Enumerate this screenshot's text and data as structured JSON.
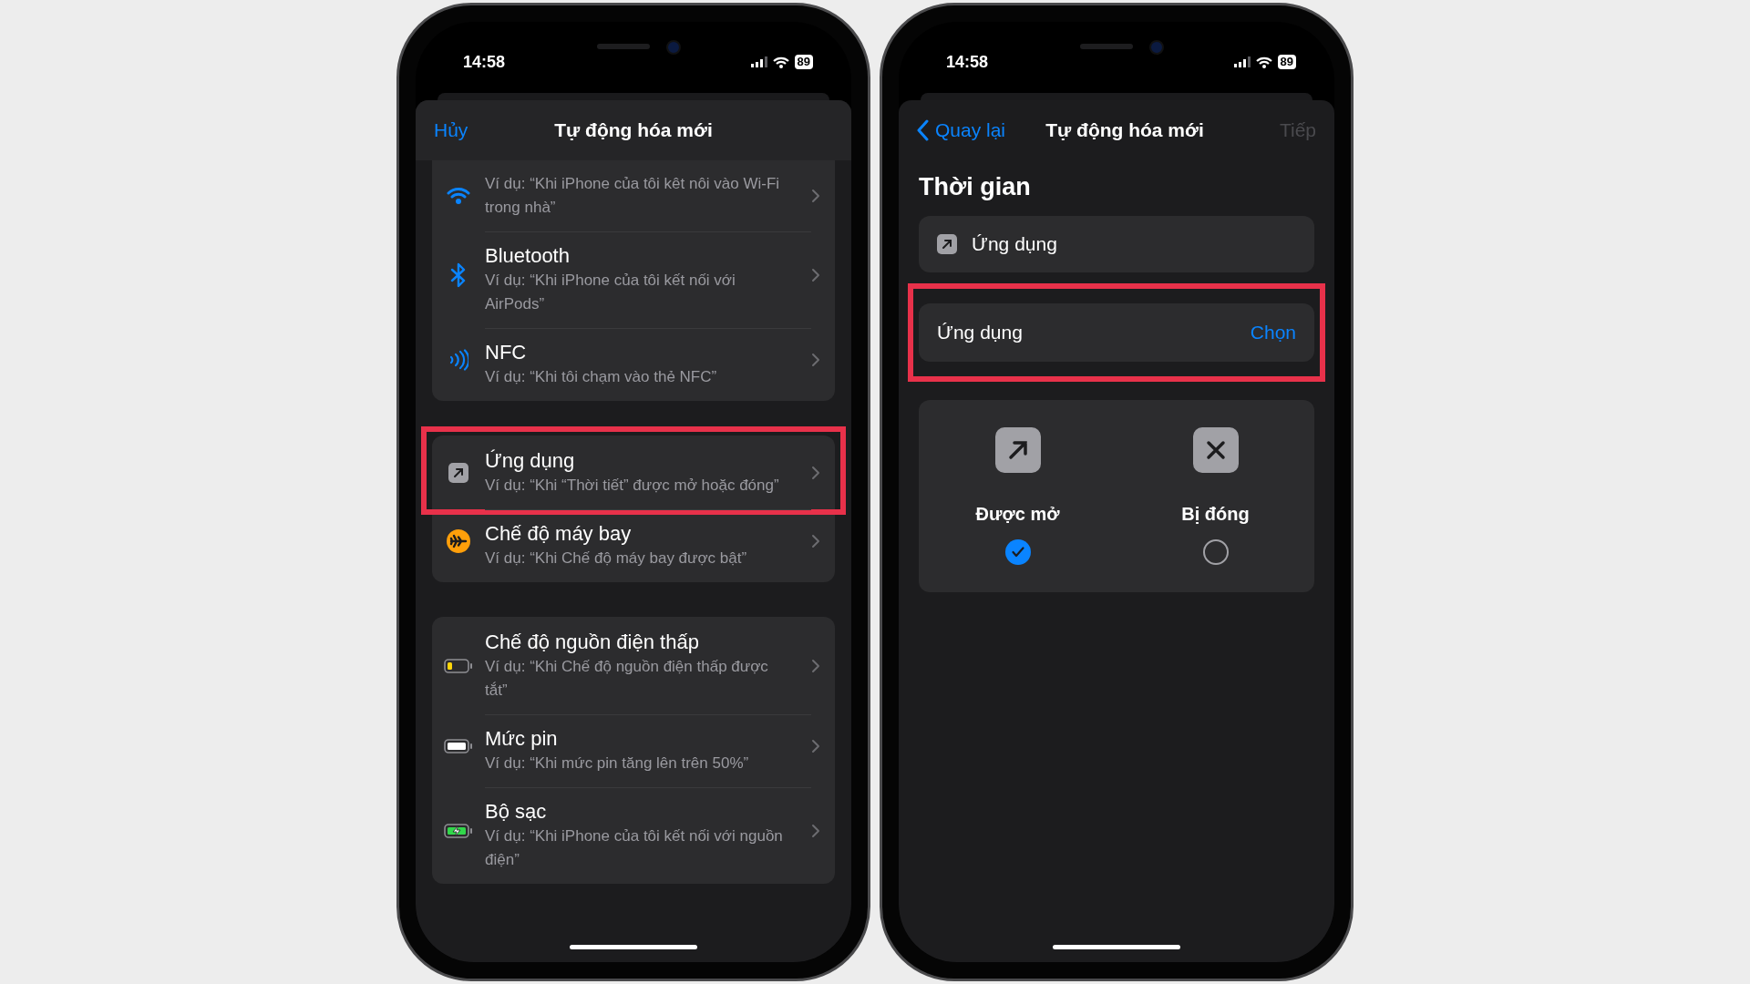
{
  "left_screen": {
    "status": {
      "time": "14:58",
      "battery": "89"
    },
    "nav": {
      "cancel": "Hủy",
      "title": "Tự động hóa mới"
    },
    "groups": [
      {
        "items": [
          {
            "kind": "wifi",
            "subtitle": "Ví dụ: “Khi iPhone của tôi kêt nôi vào Wi-Fi trong nhà”",
            "highlighted": false
          },
          {
            "kind": "bluetooth",
            "title": "Bluetooth",
            "subtitle": "Ví dụ: “Khi iPhone của tôi kết nối với AirPods”",
            "highlighted": false
          },
          {
            "kind": "nfc",
            "title": "NFC",
            "subtitle": "Ví dụ: “Khi tôi chạm vào thẻ NFC”",
            "highlighted": false
          }
        ]
      },
      {
        "items": [
          {
            "kind": "app",
            "title": "Ứng dụng",
            "subtitle": "Ví dụ: “Khi “Thời tiết” được mở hoặc đóng”",
            "highlighted": true
          },
          {
            "kind": "airplane",
            "title": "Chế độ máy bay",
            "subtitle": "Ví dụ: “Khi Chế độ máy bay được bật”",
            "highlighted": false
          }
        ]
      },
      {
        "items": [
          {
            "kind": "battery_low",
            "title": "Chế độ nguồn điện thấp",
            "subtitle": "Ví dụ: “Khi Chế độ nguồn điện thấp được tắt”",
            "highlighted": false
          },
          {
            "kind": "battery_full",
            "title": "Mức pin",
            "subtitle": "Ví dụ: “Khi mức pin tăng lên trên 50%”",
            "highlighted": false
          },
          {
            "kind": "charging",
            "title": "Bộ sạc",
            "subtitle": "Ví dụ: “Khi iPhone của tôi kết nối với nguồn điện”",
            "highlighted": false
          }
        ]
      }
    ]
  },
  "right_screen": {
    "status": {
      "time": "14:58",
      "battery": "89"
    },
    "nav": {
      "back": "Quay lại",
      "title": "Tự động hóa mới",
      "next": "Tiếp",
      "next_disabled": true
    },
    "heading": "Thời gian",
    "trigger": {
      "kind": "app",
      "label": "Ứng dụng"
    },
    "app_picker": {
      "label": "Ứng dụng",
      "action": "Chọn",
      "highlighted": true
    },
    "options": [
      {
        "kind": "open",
        "label": "Được mở",
        "selected": true
      },
      {
        "kind": "close",
        "label": "Bị đóng",
        "selected": false
      }
    ]
  }
}
